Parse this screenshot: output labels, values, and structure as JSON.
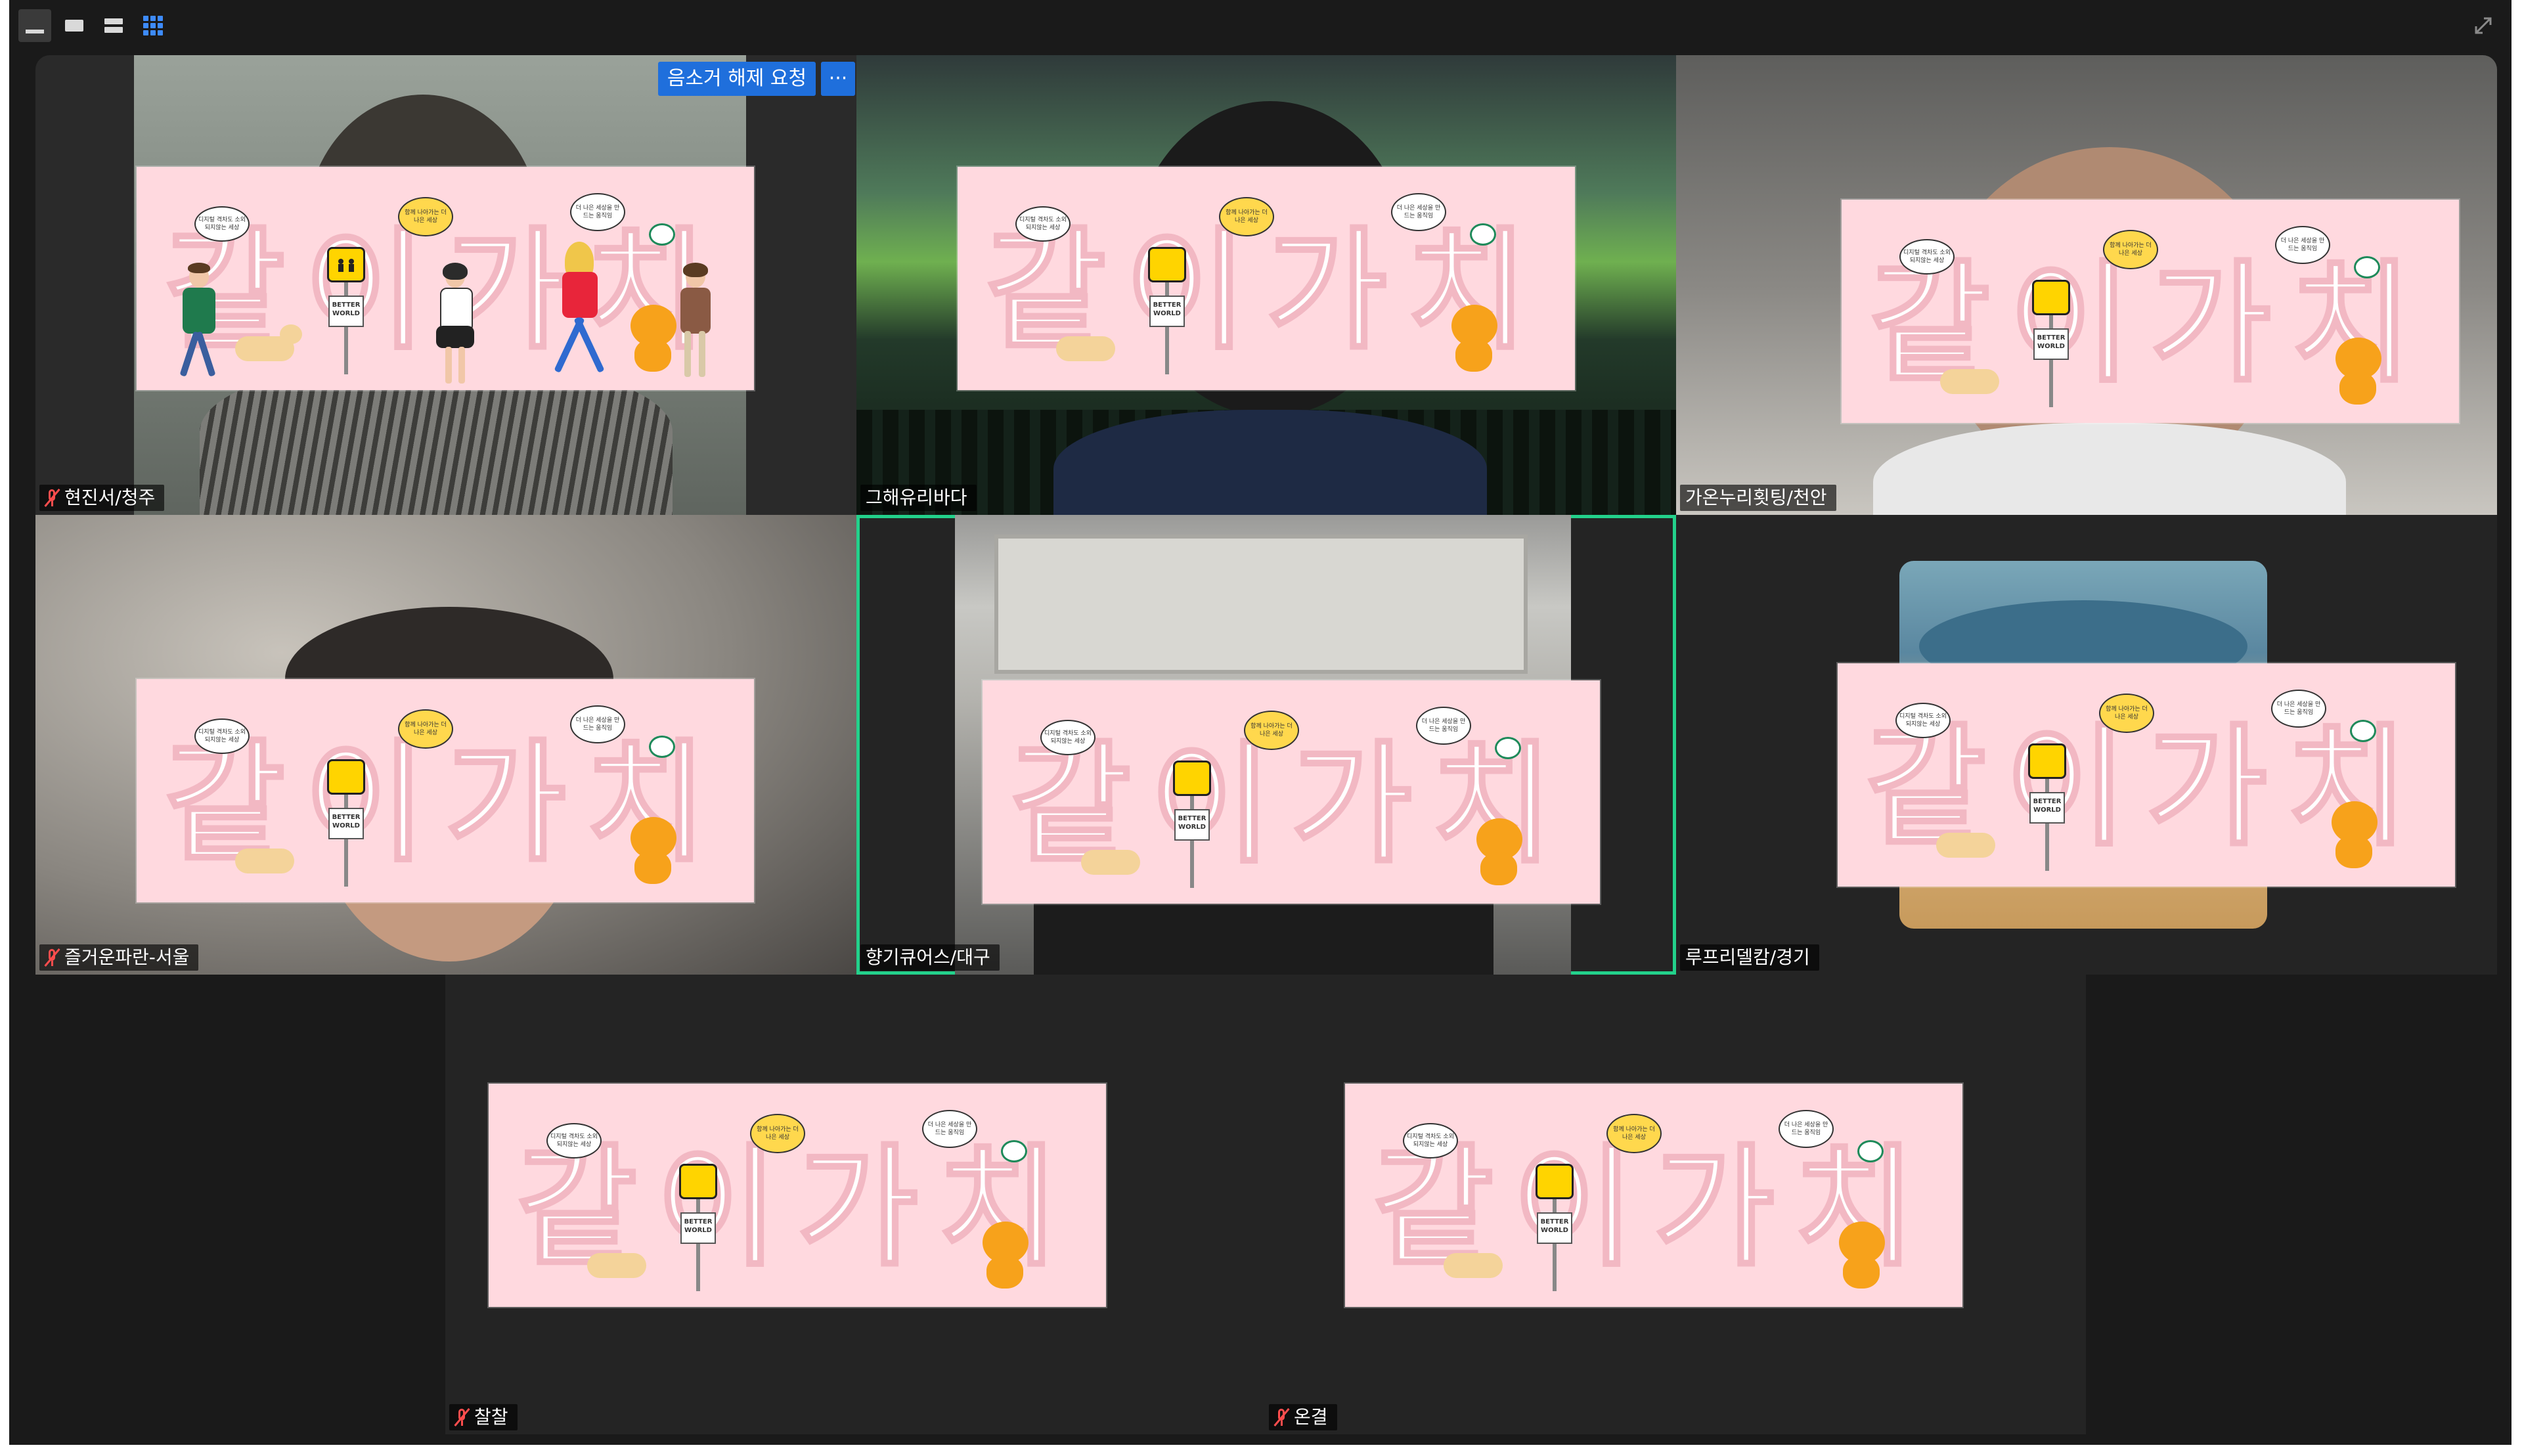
{
  "toolbar": {
    "buttons": [
      {
        "name": "minimize",
        "icon": "minimize-icon"
      },
      {
        "name": "speaker-view",
        "icon": "window-icon"
      },
      {
        "name": "strip-view",
        "icon": "stack-icon"
      },
      {
        "name": "gallery-view",
        "icon": "grid-icon",
        "active": true
      }
    ],
    "expand_icon": "fullscreen-icon"
  },
  "controls": {
    "ask_unmute_label": "음소거 해제 요청",
    "more_label": "···"
  },
  "banner": {
    "title": "같이가치",
    "bubble1": "디지털 격차도 소외되지않는 세상",
    "bubble2": "함께 나아가는 더 나은 세상",
    "bubble3": "더 나은 세상을 만드는 움직임",
    "sign_text": "BETTER WORLD"
  },
  "participants": [
    {
      "name": "현진서/청주",
      "muted": true
    },
    {
      "name": "그해유리바다",
      "muted": false
    },
    {
      "name": "가온누리횟팅/천안",
      "muted": false
    },
    {
      "name": "즐거운파란-서울",
      "muted": true
    },
    {
      "name": "향기큐어스/대구",
      "muted": false,
      "active_speaker": true
    },
    {
      "name": "루프리델캄/경기",
      "muted": false
    },
    {
      "name": "찰찰",
      "muted": true
    },
    {
      "name": "온결",
      "muted": true
    }
  ],
  "colors": {
    "background": "#1a1a1a",
    "tile": "#242424",
    "active_speaker_border": "#23d18b",
    "banner_pink": "#ffd9df",
    "accent_blue": "#1f6fdc",
    "mute_red": "#ff4d4d"
  }
}
